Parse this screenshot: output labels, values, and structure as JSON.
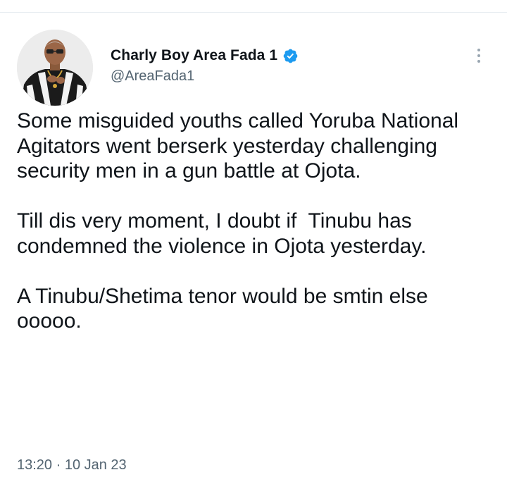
{
  "tweet": {
    "author": {
      "display_name": "Charly Boy Area Fada 1",
      "handle": "@AreaFada1",
      "verified": true,
      "verified_color": "#1d9bf0",
      "avatar_icon": "profile-photo"
    },
    "more_menu_icon": "vertical-ellipsis-icon",
    "paragraphs": [
      "Some misguided youths called Yoruba National Agitators went berserk yesterday challenging security men in a gun battle at Ojota.",
      "Till dis very moment, I doubt if  Tinubu has condemned the violence in Ojota yesterday.",
      "A Tinubu/Shetima tenor would be smtin else ooooo."
    ],
    "timestamp": "13:20 · 10 Jan 23"
  }
}
